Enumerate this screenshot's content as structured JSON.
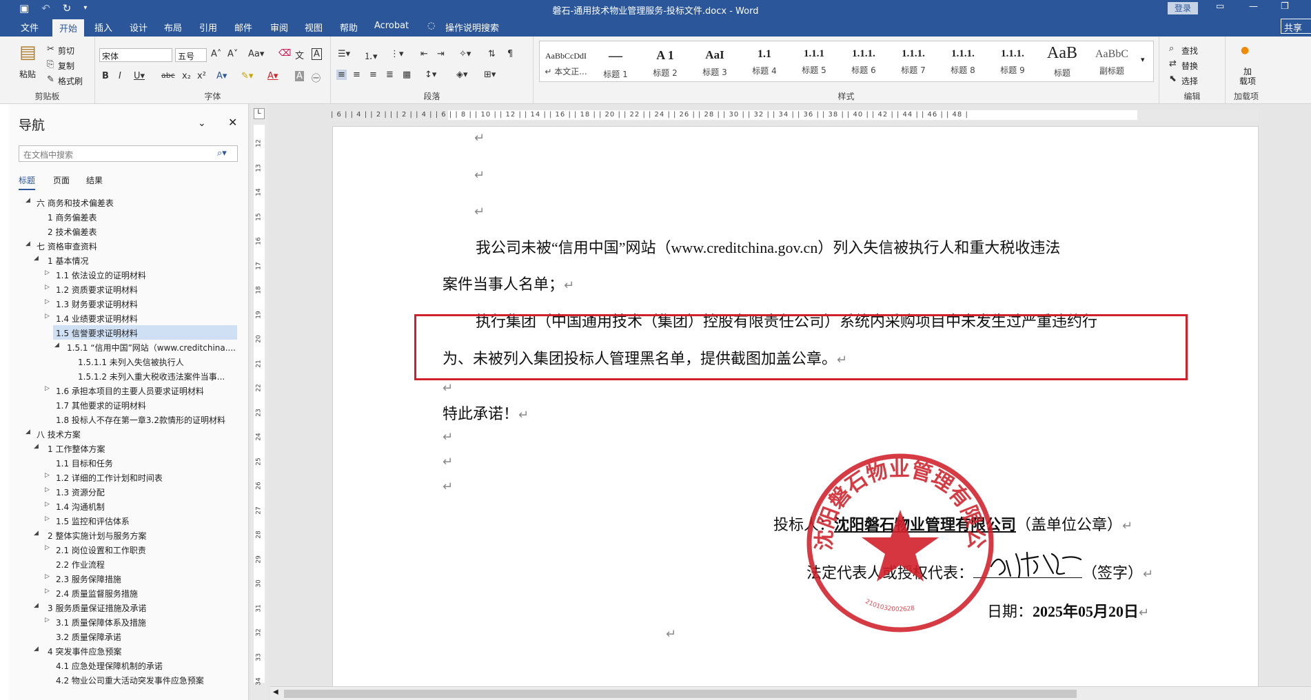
{
  "titlebar": {
    "title": "磐石-通用技术物业管理服务-投标文件.docx  -  Word",
    "login": "登录",
    "qat_icons": [
      "save-icon",
      "undo-icon",
      "redo-icon",
      "customize-icon"
    ]
  },
  "tabs": [
    "文件",
    "开始",
    "插入",
    "设计",
    "布局",
    "引用",
    "邮件",
    "审阅",
    "视图",
    "帮助",
    "Acrobat",
    "操作说明搜索"
  ],
  "share": "共享",
  "ribbon": {
    "clipboard": {
      "paste": "粘贴",
      "cut": "剪切",
      "copy": "复制",
      "painter": "格式刷",
      "label": "剪贴板"
    },
    "font": {
      "name": "宋体",
      "size": "五号",
      "label": "字体"
    },
    "paragraph": {
      "label": "段落"
    },
    "styles": {
      "label": "样式",
      "items": [
        {
          "preview": "AaBbCcDdI",
          "name": "↵ 本文正..."
        },
        {
          "preview": "—",
          "name": "标题 1"
        },
        {
          "preview": "A 1",
          "name": "标题 2"
        },
        {
          "preview": "AaI",
          "name": "标题 3"
        },
        {
          "preview": "1.1",
          "name": "标题 4"
        },
        {
          "preview": "1.1.1",
          "name": "标题 5"
        },
        {
          "preview": "1.1.1.",
          "name": "标题 6"
        },
        {
          "preview": "1.1.1.",
          "name": "标题 7"
        },
        {
          "preview": "1.1.1.",
          "name": "标题 8"
        },
        {
          "preview": "1.1.1.",
          "name": "标题 9"
        },
        {
          "preview": "1.1.1.",
          "name": "标题"
        },
        {
          "preview": "AaB",
          "name": "副标题"
        },
        {
          "preview": "AaBbC",
          "name": ""
        }
      ]
    },
    "editing": {
      "find": "查找",
      "replace": "替换",
      "select": "选择",
      "label": "编辑"
    },
    "addins": {
      "btn": "加\n载项",
      "label": "加载项"
    }
  },
  "nav": {
    "title": "导航",
    "search_placeholder": "在文档中搜索",
    "tabs": [
      "标题",
      "页面",
      "结果"
    ],
    "headings": [
      {
        "level": 0,
        "tw": "◢",
        "text": "六 商务和技术偏差表"
      },
      {
        "level": 1,
        "tw": "",
        "text": "1 商务偏差表"
      },
      {
        "level": 1,
        "tw": "",
        "text": "2 技术偏差表"
      },
      {
        "level": 0,
        "tw": "◢",
        "text": "七 资格审查资料"
      },
      {
        "level": 1,
        "tw": "◢",
        "text": "1 基本情况"
      },
      {
        "level": 2,
        "tw": "▷",
        "text": "1.1 依法设立的证明材料"
      },
      {
        "level": 2,
        "tw": "▷",
        "text": "1.2 资质要求证明材料"
      },
      {
        "level": 2,
        "tw": "▷",
        "text": "1.3 财务要求证明材料"
      },
      {
        "level": 2,
        "tw": "▷",
        "text": "1.4 业绩要求证明材料"
      },
      {
        "level": 2,
        "tw": "◢",
        "text": "1.5 信誉要求证明材料",
        "selected": true
      },
      {
        "level": 3,
        "tw": "◢",
        "text": "1.5.1 “信用中国”网站（www.creditchina...."
      },
      {
        "level": 4,
        "tw": "",
        "text": "1.5.1.1 未列入失信被执行人"
      },
      {
        "level": 4,
        "tw": "",
        "text": "1.5.1.2 未列入重大税收违法案件当事..."
      },
      {
        "level": 2,
        "tw": "▷",
        "text": "1.6 承担本项目的主要人员要求证明材料"
      },
      {
        "level": 2,
        "tw": "",
        "text": "1.7 其他要求的证明材料"
      },
      {
        "level": 2,
        "tw": "",
        "text": "1.8 投标人不存在第一章3.2款情形的证明材料"
      },
      {
        "level": 0,
        "tw": "◢",
        "text": "八 技术方案"
      },
      {
        "level": 1,
        "tw": "◢",
        "text": "1 工作整体方案"
      },
      {
        "level": 2,
        "tw": "",
        "text": "1.1 目标和任务"
      },
      {
        "level": 2,
        "tw": "▷",
        "text": "1.2 详细的工作计划和时间表"
      },
      {
        "level": 2,
        "tw": "▷",
        "text": "1.3 资源分配"
      },
      {
        "level": 2,
        "tw": "▷",
        "text": "1.4 沟通机制"
      },
      {
        "level": 2,
        "tw": "▷",
        "text": "1.5 监控和评估体系"
      },
      {
        "level": 1,
        "tw": "◢",
        "text": "2 整体实施计划与服务方案"
      },
      {
        "level": 2,
        "tw": "▷",
        "text": "2.1 岗位设置和工作职责"
      },
      {
        "level": 2,
        "tw": "",
        "text": "2.2 作业流程"
      },
      {
        "level": 2,
        "tw": "▷",
        "text": "2.3 服务保障措施"
      },
      {
        "level": 2,
        "tw": "▷",
        "text": "2.4 质量监督服务措施"
      },
      {
        "level": 1,
        "tw": "◢",
        "text": "3 服务质量保证措施及承诺"
      },
      {
        "level": 2,
        "tw": "▷",
        "text": "3.1 质量保障体系及措施"
      },
      {
        "level": 2,
        "tw": "",
        "text": "3.2 质量保障承诺"
      },
      {
        "level": 1,
        "tw": "◢",
        "text": "4 突发事件应急预案"
      },
      {
        "level": 2,
        "tw": "",
        "text": "4.1 应急处理保障机制的承诺"
      },
      {
        "level": 2,
        "tw": "",
        "text": "4.2 物业公司重大活动突发事件应急预案"
      }
    ]
  },
  "ruler": {
    "h": "| 6 |   | 4 |   | 2 |   |       | 2 |   | 4 |   | 6 |   | 8 |   | 10 |  | 12 |  | 14 |  | 16 |  | 18 |  | 20 |  | 22 |  | 24 |  | 26 |  | 28 |  | 30 |  | 32 |  | 34 |  | 36 |  | 38 |  | 40 |  | 42 |  | 44 |  | 46 |  | 48 |",
    "v": [
      "12",
      "13",
      "14",
      "15",
      "16",
      "17",
      "18",
      "19",
      "20",
      "21",
      "22",
      "23",
      "24",
      "25",
      "26",
      "27",
      "28",
      "29",
      "30",
      "31",
      "32",
      "33",
      "34"
    ]
  },
  "document": {
    "p1_l1": "我公司未被“信用中国”网站（www.creditchina.gov.cn）列入失信被执行人和重大税收违法",
    "p1_l2": "案件当事人名单；",
    "p2_l1": "执行集团（中国通用技术（集团）控股有限责任公司）系统内采购项目中未发生过严重违约行",
    "p2_l2": "为、未被列入集团投标人管理黑名单，提供截图加盖公章。",
    "pledge": "特此承诺！",
    "bidder_label": "投标人：",
    "bidder_name": "沈阳磐石物业管理有限公司",
    "bidder_note": "（盖单位公章）",
    "rep_label": "法定代表人或授权代表：",
    "rep_note": "（签字）",
    "date_label": "日期：",
    "date_value": "2025年05月20日",
    "pilcrow": "↵",
    "stamp_text": "沈阳磐石物业管理有限公司",
    "stamp_number": "2101032002628"
  },
  "colors": {
    "accent": "#2b579a",
    "stamp": "#d0202a",
    "highlight_box": "#d0202a"
  }
}
